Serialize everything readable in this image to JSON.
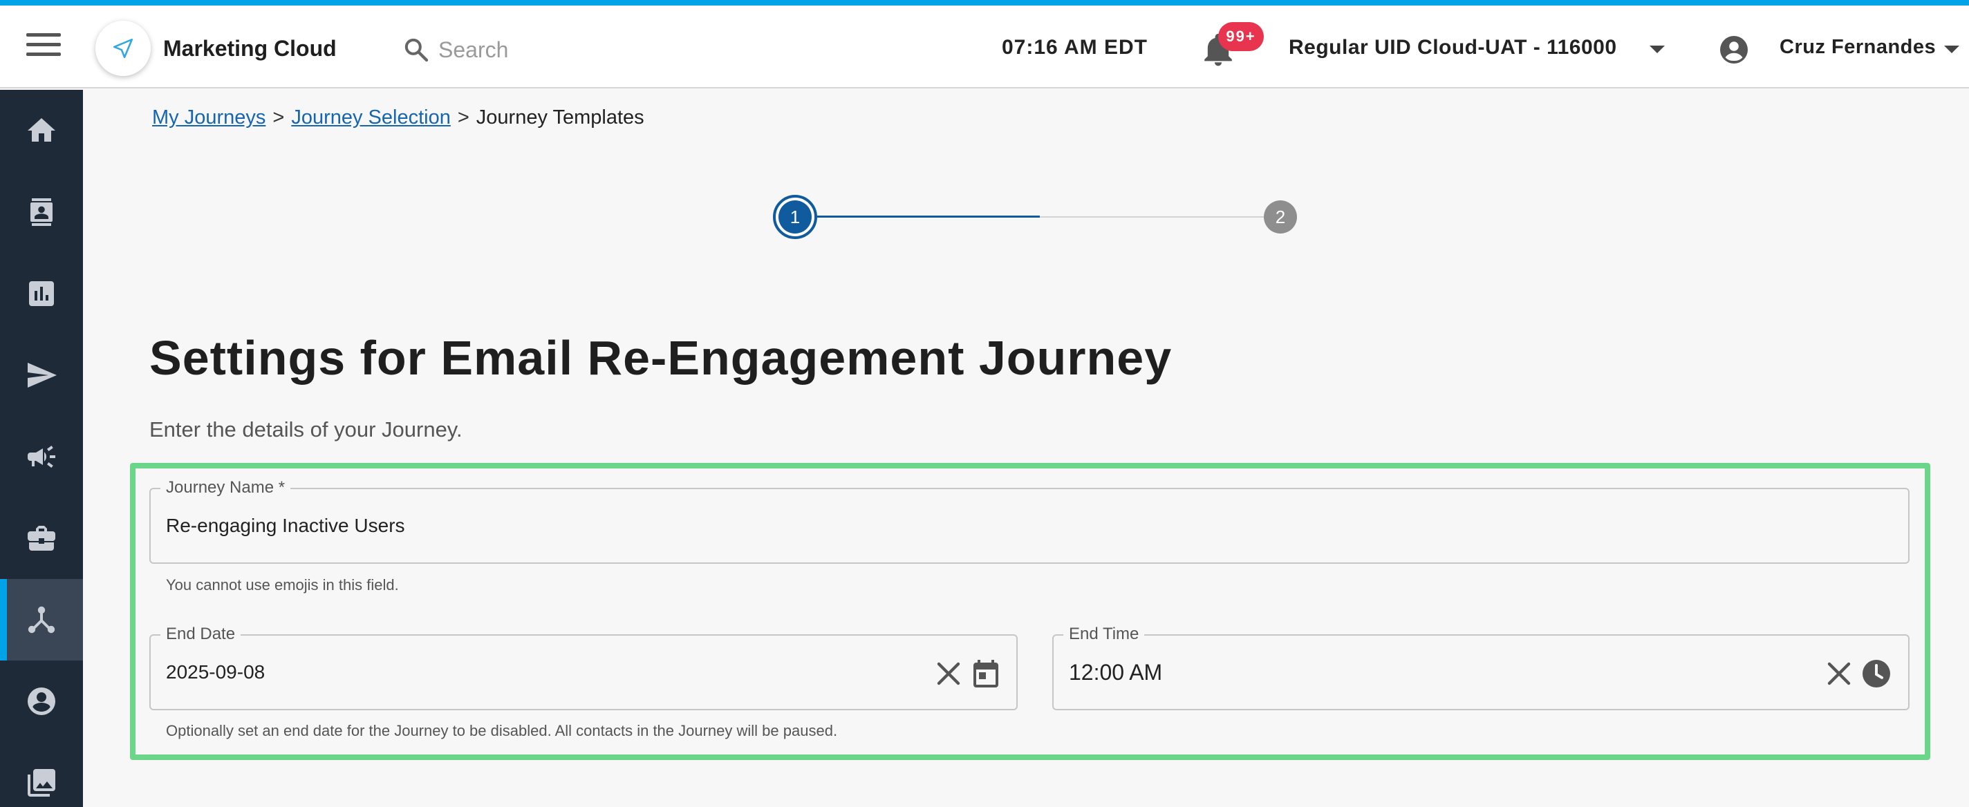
{
  "header": {
    "app_title": "Marketing Cloud",
    "search_placeholder": "Search",
    "time": "07:16 AM EDT",
    "notification_badge": "99+",
    "org_name": "Regular UID Cloud-UAT - 116000",
    "user_name": "Cruz Fernandes",
    "accent_color": "#00a3e8"
  },
  "sidebar": {
    "items": [
      {
        "icon": "home-icon"
      },
      {
        "icon": "contacts-icon"
      },
      {
        "icon": "bar-chart-icon"
      },
      {
        "icon": "send-icon"
      },
      {
        "icon": "megaphone-icon"
      },
      {
        "icon": "briefcase-icon"
      },
      {
        "icon": "journey-icon",
        "active": true
      },
      {
        "icon": "account-circle-icon"
      },
      {
        "icon": "image-library-icon"
      }
    ]
  },
  "breadcrumb": {
    "items": [
      "My Journeys",
      "Journey Selection",
      "Journey Templates"
    ],
    "separator": ">"
  },
  "stepper": {
    "steps": [
      "1",
      "2"
    ],
    "current_step": 1
  },
  "page": {
    "title": "Settings for Email Re-Engagement Journey",
    "subtitle": "Enter the details of your Journey."
  },
  "form": {
    "journey_name": {
      "label": "Journey Name *",
      "value": "Re-engaging Inactive Users",
      "helper": "You cannot use emojis in this field."
    },
    "end_date": {
      "label": "End Date",
      "value": "2025-09-08",
      "helper": "Optionally set an end date for the Journey to be disabled. All contacts in the Journey will be paused."
    },
    "end_time": {
      "label": "End Time",
      "value": "12:00 AM"
    },
    "highlight_color": "#6bd68a"
  }
}
